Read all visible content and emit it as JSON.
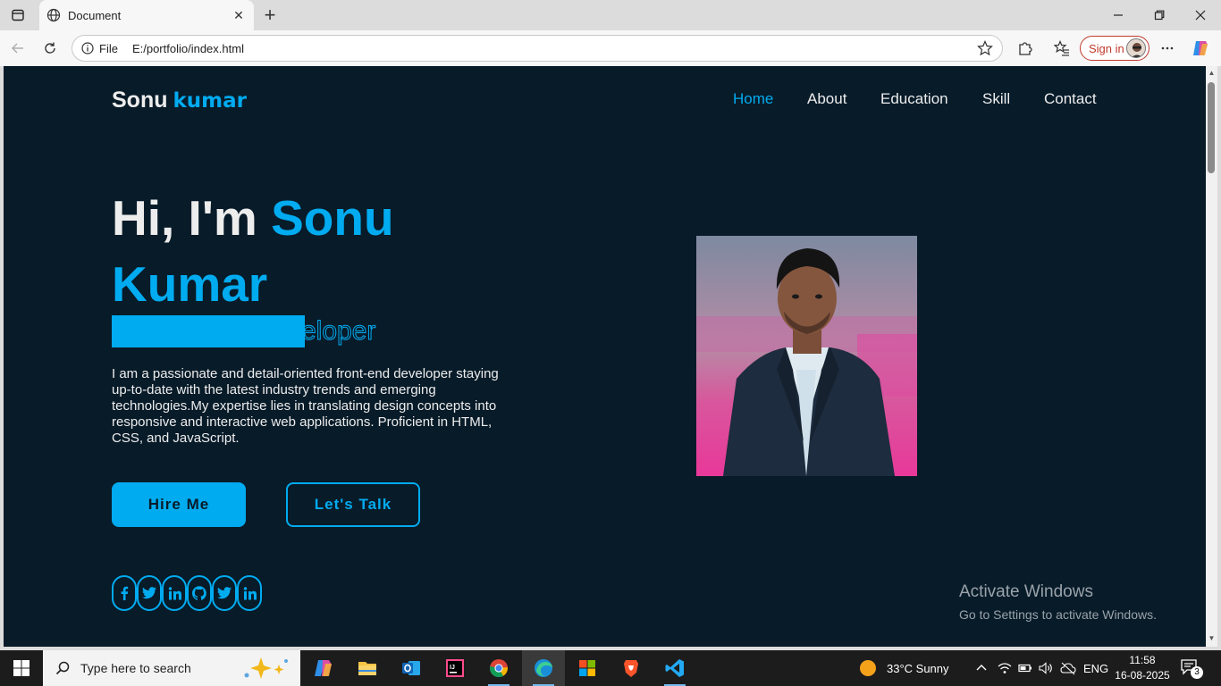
{
  "browser": {
    "tab_title": "Document",
    "address_label": "File",
    "url": "E:/portfolio/index.html",
    "signin_label": "Sign in"
  },
  "page": {
    "logo": {
      "first": "Sonu",
      "accent": "kumar"
    },
    "nav": [
      "Home",
      "About",
      "Education",
      "Skill",
      "Contact"
    ],
    "nav_active": "Home",
    "hero": {
      "greeting": "Hi, I'm",
      "first_name": "Sonu",
      "last_name": "Kumar",
      "typing_visible": "eloper",
      "description": "I am a passionate and detail-oriented front-end developer staying up-to-date with the latest industry trends and emerging technologies.My expertise lies in translating design concepts into responsive and interactive web applications. Proficient in HTML, CSS, and JavaScript.",
      "btn_primary": "Hire Me",
      "btn_secondary": "Let's Talk"
    },
    "social_icons": [
      "facebook-icon",
      "twitter-icon",
      "linkedin-icon",
      "github-icon",
      "twitter-icon",
      "linkedin-icon"
    ],
    "accent_color": "#00abf0",
    "background_color": "#081b29"
  },
  "watermark": {
    "title": "Activate Windows",
    "subtitle": "Go to Settings to activate Windows."
  },
  "taskbar": {
    "search_placeholder": "Type here to search",
    "weather": "33°C  Sunny",
    "language": "ENG",
    "time": "11:58",
    "date": "16-08-2025",
    "notification_count": "3"
  }
}
